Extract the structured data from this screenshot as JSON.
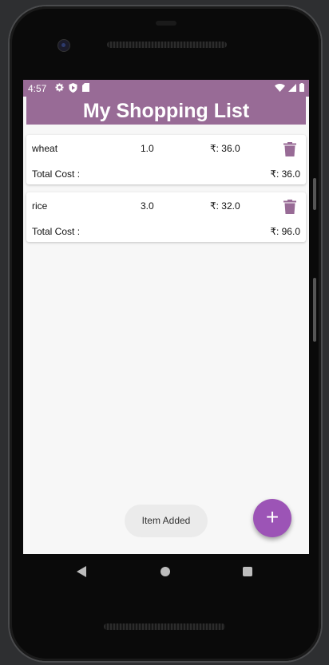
{
  "status_bar": {
    "time": "4:57",
    "left_icons": [
      "gear-icon",
      "play-protect-icon",
      "sd-card-icon"
    ],
    "right_icons": [
      "wifi-icon",
      "signal-icon",
      "battery-icon"
    ]
  },
  "app_bar": {
    "title": "My Shopping List"
  },
  "items": [
    {
      "name": "wheat",
      "quantity": "1.0",
      "price": "₹: 36.0",
      "total_label": "Total Cost :",
      "total_value": "₹: 36.0"
    },
    {
      "name": "rice",
      "quantity": "3.0",
      "price": "₹: 32.0",
      "total_label": "Total Cost :",
      "total_value": "₹: 96.0"
    }
  ],
  "toast": {
    "message": "Item Added"
  },
  "fab": {
    "label": "+"
  },
  "colors": {
    "primary": "#986b96",
    "fab": "#9c54b6",
    "delete_icon": "#986b96"
  }
}
